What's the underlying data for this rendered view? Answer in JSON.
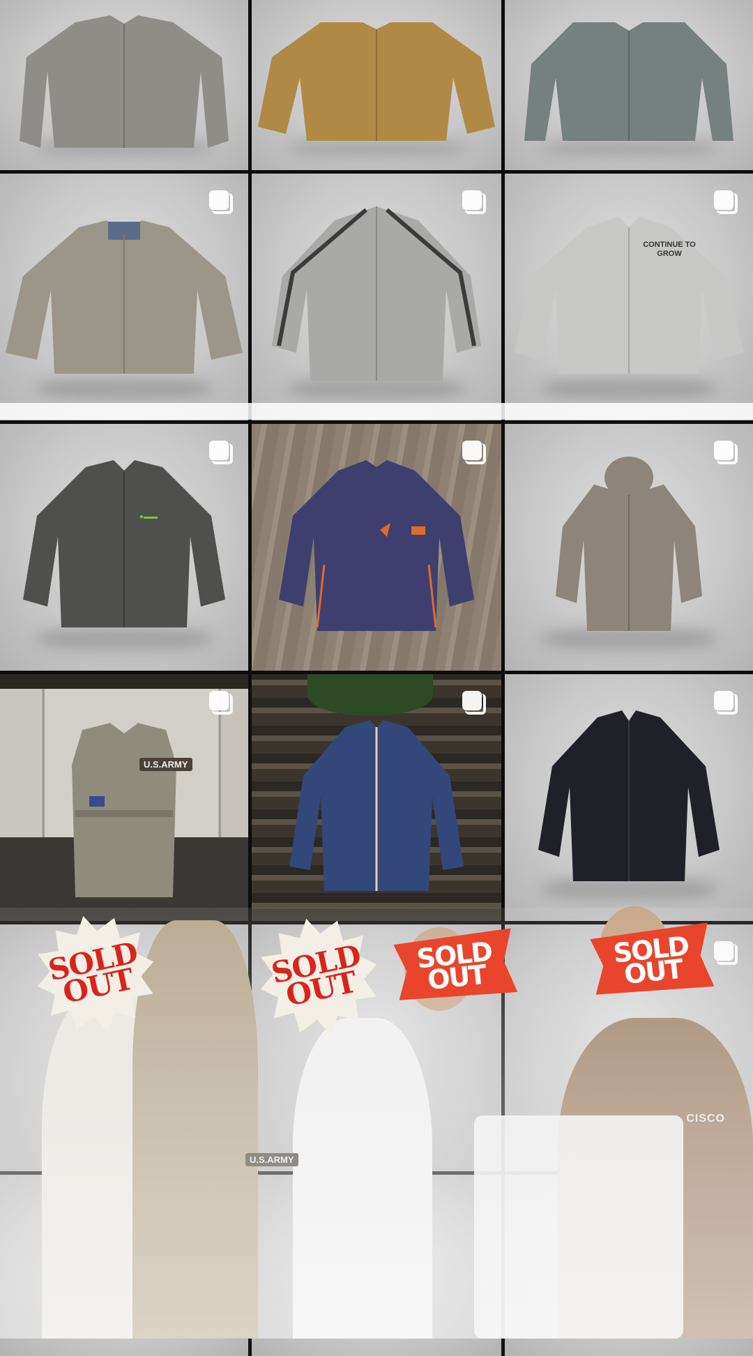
{
  "grid": {
    "posts": [
      {
        "id": "post-1",
        "garment": "grey-jacket",
        "color": "#8e8d88",
        "carousel": false,
        "bg": "grey"
      },
      {
        "id": "post-2",
        "garment": "mustard-jacket",
        "color": "#b08a45",
        "carousel": false,
        "bg": "grey"
      },
      {
        "id": "post-3",
        "garment": "slate-jacket",
        "color": "#76807e",
        "carousel": false,
        "bg": "grey"
      },
      {
        "id": "post-4",
        "garment": "taupe-jacket",
        "color": "#9c958a",
        "carousel": true,
        "bg": "grey"
      },
      {
        "id": "post-5",
        "garment": "silver-track-jacket",
        "color": "#a9aaa8",
        "carousel": true,
        "bg": "grey"
      },
      {
        "id": "post-6",
        "garment": "light-coach-jacket",
        "color": "#c7c7c5",
        "carousel": true,
        "bg": "grey"
      },
      {
        "id": "post-7",
        "garment": "charcoal-work-jacket",
        "color": "#4f4f4d",
        "carousel": true,
        "bg": "grey"
      },
      {
        "id": "post-8",
        "garment": "navy-windbreaker",
        "color": "#3e3f6e",
        "carousel": true,
        "bg": "wood"
      },
      {
        "id": "post-9",
        "garment": "beige-hooded-jacket",
        "color": "#8d857b",
        "carousel": true,
        "bg": "grey"
      },
      {
        "id": "post-10",
        "garment": "khaki-vest",
        "color": "#8f8c7e",
        "carousel": true,
        "bg": "paving"
      },
      {
        "id": "post-11",
        "garment": "navy-parka",
        "color": "#34477a",
        "carousel": true,
        "bg": "darkwood"
      },
      {
        "id": "post-12",
        "garment": "black-jacket",
        "color": "#202128",
        "carousel": true,
        "bg": "grey"
      },
      {
        "id": "post-13",
        "garment": "person-white-shirt",
        "color": "#d9d4cc",
        "carousel": true,
        "bg": "grey"
      },
      {
        "id": "post-14",
        "garment": "person-khaki-shirt",
        "color": "#b4a489",
        "carousel": false,
        "bg": "grey"
      },
      {
        "id": "post-15",
        "garment": "person-white-tee",
        "color": "#f0f0f0",
        "carousel": false,
        "bg": "grey"
      },
      {
        "id": "post-16",
        "garment": "person-brown-jacket",
        "color": "#9a7b5e",
        "carousel": true,
        "bg": "grey"
      }
    ]
  },
  "prints": {
    "coach_jacket": "CONTINUE TO GROW",
    "vest_patch": "U.S.ARMY",
    "shirt_patch": "U.S.ARMY",
    "cisco": "CISCO"
  },
  "badges": {
    "sold_out_1": "SOLD OUT",
    "sold_out_2": "SOLD OUT",
    "sold_out_3": "SOLD OUT",
    "sold_out_4": "SOLD OUT"
  },
  "colors": {
    "sold_out_red": "#d9241c",
    "flag_orange": "#e8452c",
    "burst_cream": "#f3efe6"
  }
}
